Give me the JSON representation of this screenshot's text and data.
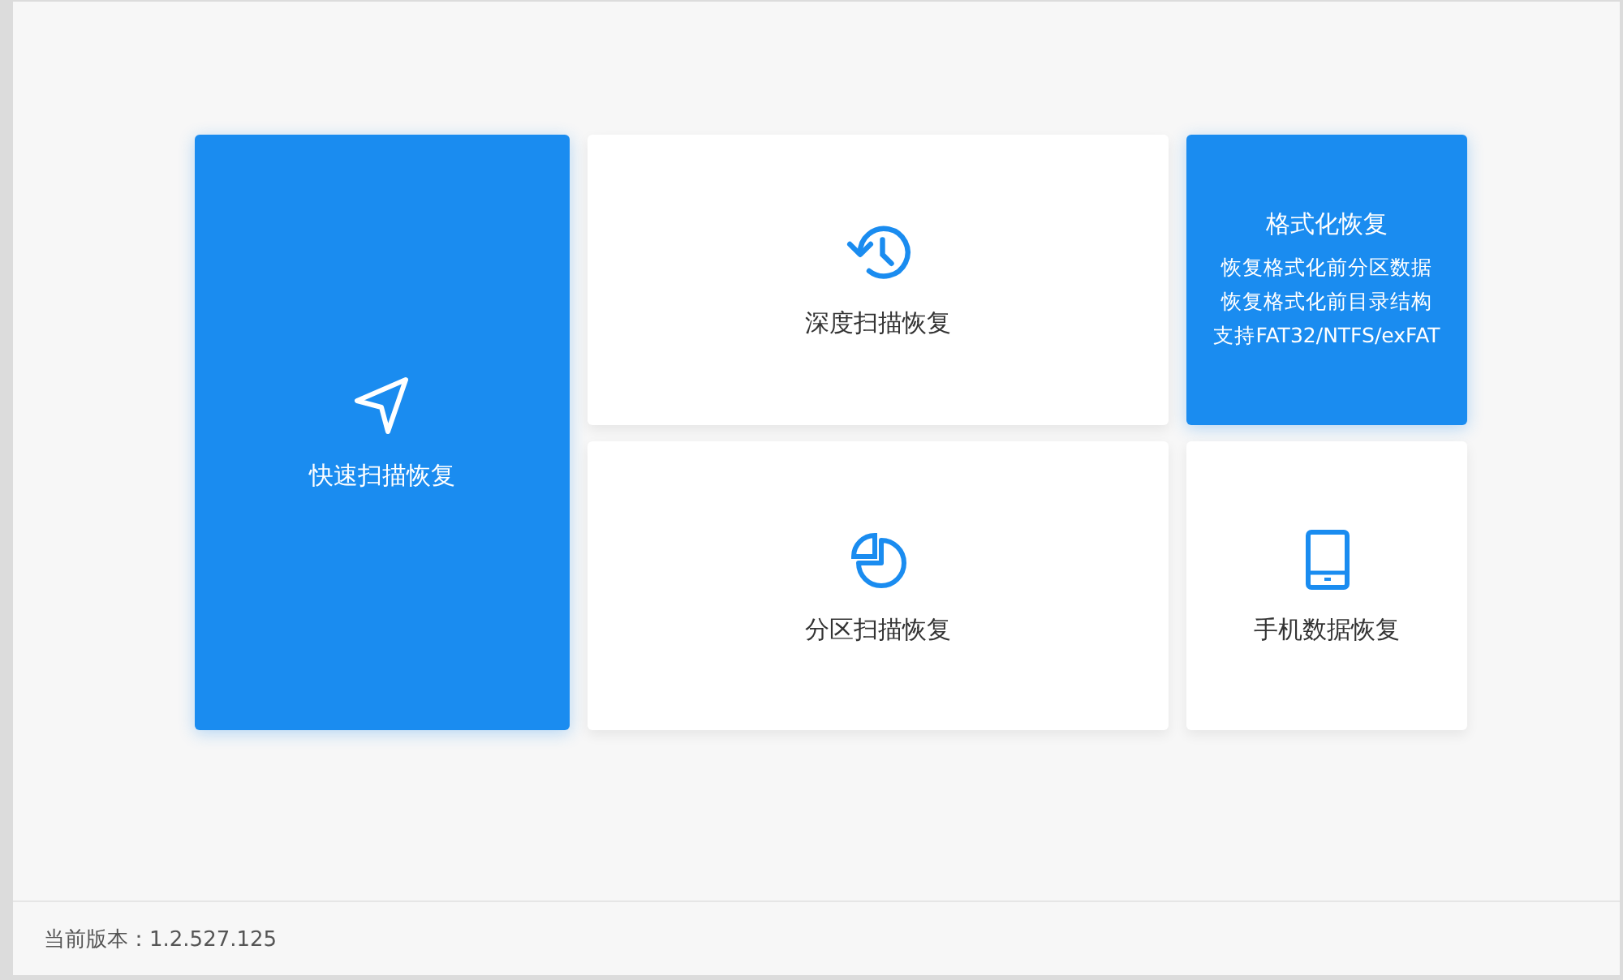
{
  "tiles": [
    {
      "title": "快速扫描恢复",
      "kind": "icon",
      "highlighted": true
    },
    {
      "title": "深度扫描恢复",
      "kind": "icon",
      "highlighted": false
    },
    {
      "title": "格式化恢复",
      "kind": "detail",
      "highlighted": true,
      "lines": [
        "恢复格式化前分区数据",
        "恢复格式化前目录结构",
        "支持FAT32/NTFS/exFAT"
      ]
    },
    {
      "title": "分区扫描恢复",
      "kind": "icon",
      "highlighted": false
    },
    {
      "title": "手机数据恢复",
      "kind": "icon",
      "highlighted": false
    }
  ],
  "status_bar": {
    "version": "当前版本：1.2.527.125"
  }
}
